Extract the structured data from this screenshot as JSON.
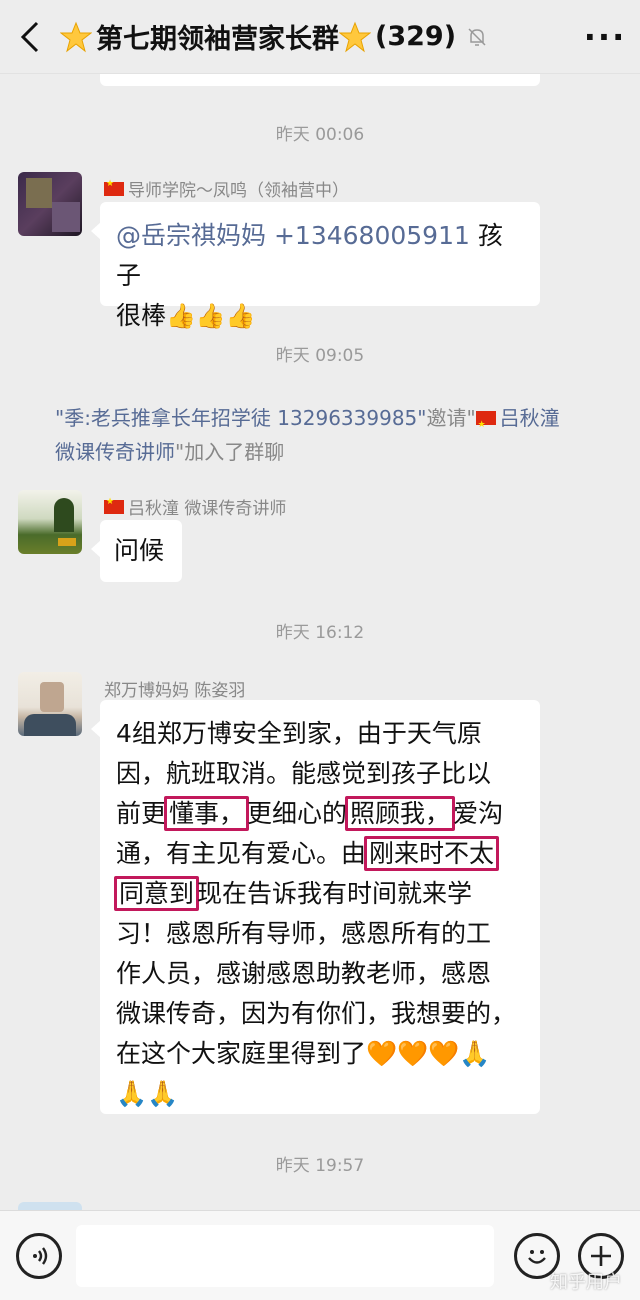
{
  "header": {
    "title": "第七期领袖营家长群",
    "member_count": "(329)"
  },
  "messages": [
    {
      "time": "昨天 00:06"
    },
    {
      "sender": "导师学院～凤鸣（领袖营中）",
      "mention": "@岳宗祺妈妈",
      "phone": "+13468005911",
      "text_after": "孩子",
      "line2": "很棒"
    },
    {
      "time": "昨天 09:05"
    },
    {
      "system_part1": "\"季:老兵推拿长年招学徒 13296339985\"",
      "system_part2": "邀请\"",
      "system_part3": "吕秋潼",
      "system_part4": "微课传奇讲师",
      "system_part5": "\"加入了群聊"
    },
    {
      "sender": "吕秋潼 微课传奇讲师",
      "text": "问候"
    },
    {
      "time": "昨天 16:12"
    },
    {
      "sender": "郑万博妈妈  陈姿羽",
      "lines": [
        "4组郑万博安全到家，由于天气原",
        "因，航班取消。能感觉到孩子比以",
        "前更",
        "懂事，",
        "更细心的",
        "照顾我，",
        "爱沟",
        "通，有主见有爱心。由",
        "刚来时不太",
        "同意到",
        "现在告诉我有时间就来学",
        "习！感恩所有导师，感恩所有的工",
        "作人员，感谢感恩助教老师，感恩",
        "微课传奇，因为有你们，我想要的，",
        "在这个大家庭里得到了"
      ]
    },
    {
      "time": "昨天 19:57"
    }
  ],
  "watermark": "知乎用户"
}
